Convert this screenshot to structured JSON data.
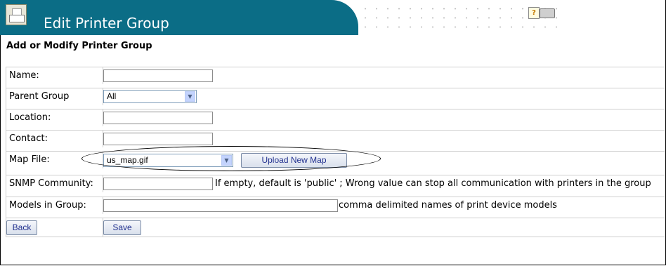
{
  "header": {
    "title": "Edit Printer Group",
    "app_icon": "printer-group-icon",
    "help_icon": "help-icon",
    "printer_icon": "printer-icon"
  },
  "subtitle": "Add or Modify Printer Group",
  "form": {
    "name_label": "Name:",
    "name_value": "",
    "parent_label": "Parent Group",
    "parent_value": "All",
    "location_label": "Location:",
    "location_value": "",
    "contact_label": "Contact:",
    "contact_value": "",
    "map_label": "Map File:",
    "map_value": "us_map.gif",
    "upload_label": "Upload New Map",
    "snmp_label": "SNMP Community:",
    "snmp_value": "",
    "snmp_note": "If empty, default is 'public' ; Wrong value can stop all communication with printers in the group",
    "models_label": "Models in Group:",
    "models_value": "",
    "models_note": "comma delimited names of print device models",
    "back_label": "Back",
    "save_label": "Save"
  },
  "colors": {
    "banner": "#0b6d86",
    "button_text": "#22318f"
  }
}
